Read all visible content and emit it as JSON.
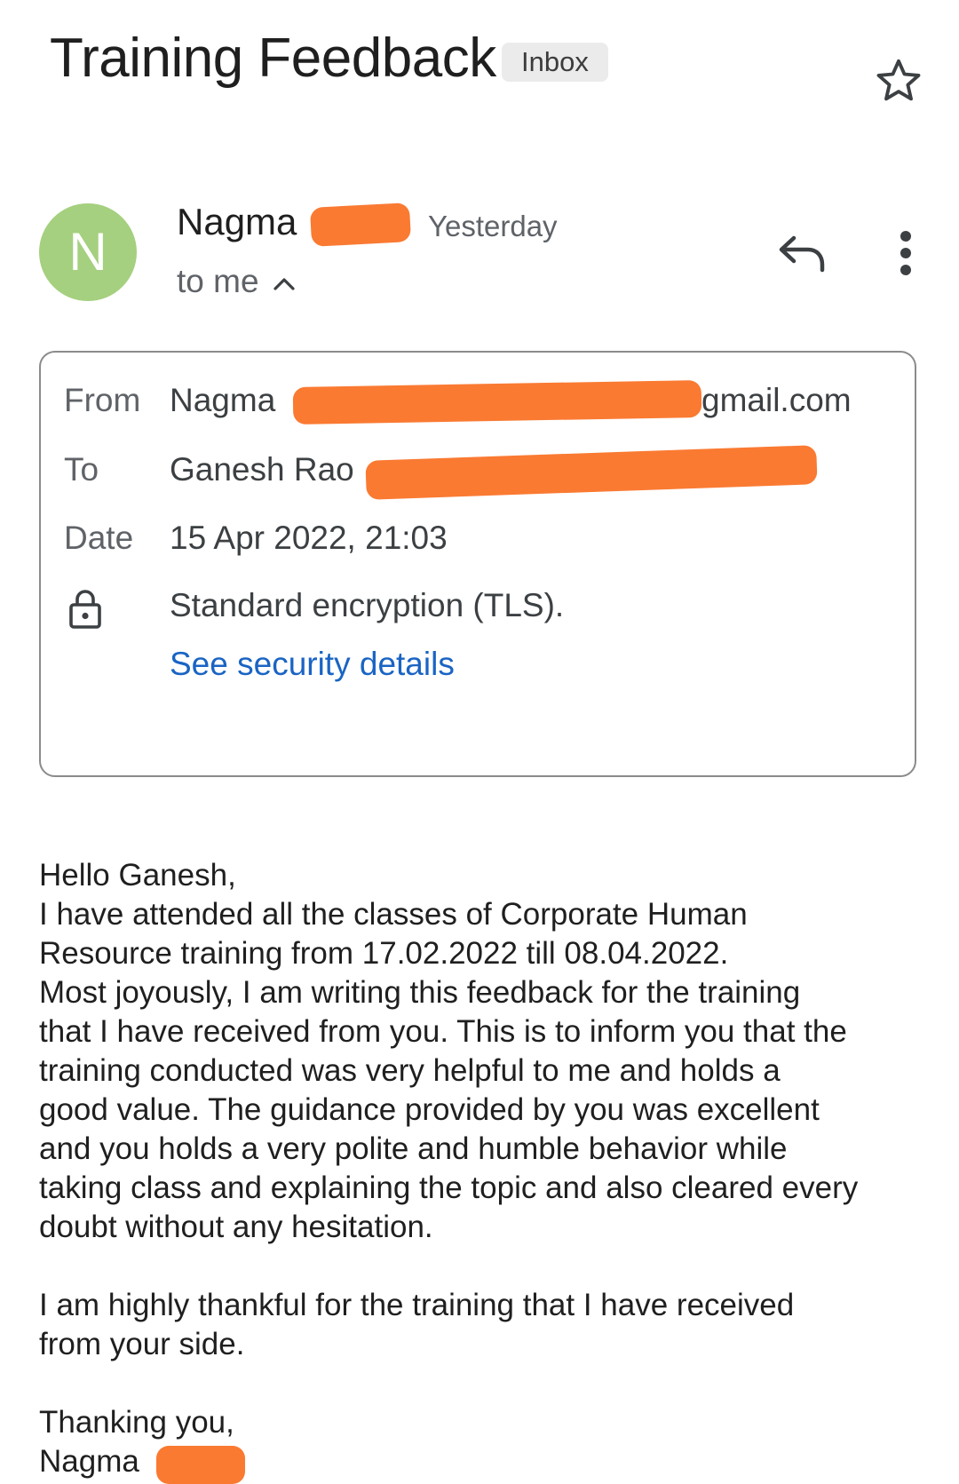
{
  "header": {
    "subject": "Training Feedback",
    "label_chip": "Inbox",
    "star_icon": "star-outline-icon"
  },
  "message": {
    "avatar_letter": "N",
    "avatar_color": "#a5d07f",
    "sender_name": "Nagma",
    "time": "Yesterday",
    "recipient_summary": "to me",
    "reply_icon": "reply-icon",
    "more_icon": "more-vert-icon"
  },
  "details": {
    "from_label": "From",
    "from_name": "Nagma",
    "from_email_fragment": "gmail.com",
    "to_label": "To",
    "to_name": "Ganesh Rao",
    "date_label": "Date",
    "date_value": "15 Apr 2022, 21:03",
    "security_icon": "lock-icon",
    "encryption_text": "Standard encryption (TLS).",
    "security_link": "See security details",
    "link_color": "#1a64c4",
    "redaction_color": "#fa7a32"
  },
  "body": {
    "paragraph_1": "Hello Ganesh,\nI have attended all the classes of Corporate Human\nResource training from 17.02.2022 till 08.04.2022.\nMost joyously, I am writing this feedback for the training\nthat I have received from you. This is to inform you that the\ntraining conducted was very helpful to me and holds a\ngood value. The guidance provided by you was excellent\nand you holds a very polite and humble behavior while\ntaking class and explaining the topic and also cleared every\ndoubt without any hesitation.",
    "paragraph_2": "I am highly thankful  for the training that I have received\nfrom your side.",
    "closing": "Thanking you,",
    "signature_name": "Nagma"
  }
}
